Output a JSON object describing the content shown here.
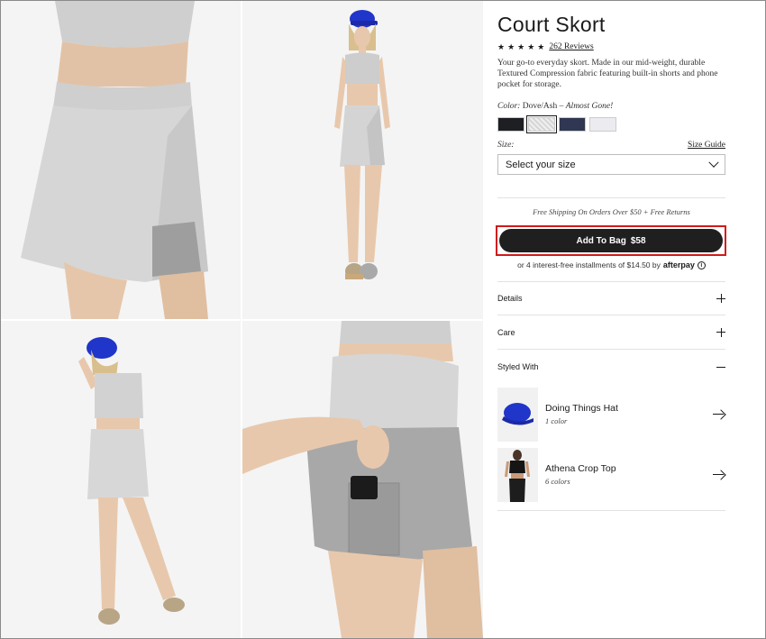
{
  "product": {
    "title": "Court Skort",
    "stars": "★★★★★",
    "reviews": "262 Reviews",
    "description": "Your go-to everyday skort. Made in our mid-weight, durable Textured Compression fabric featuring built-in shorts and phone pocket for storage."
  },
  "color": {
    "label": "Color:",
    "value": "Dove/Ash",
    "separator": "–",
    "availability": "Almost Gone!",
    "swatches": [
      "Black",
      "Dove/Ash",
      "Navy",
      "White"
    ],
    "selected": "Dove/Ash"
  },
  "size": {
    "label": "Size:",
    "guide": "Size Guide",
    "placeholder": "Select your size"
  },
  "shipping": "Free Shipping On Orders Over $50 + Free Returns",
  "add_to_bag": {
    "label": "Add To Bag",
    "price": "$58"
  },
  "afterpay": {
    "text": "or 4 interest-free installments of $14.50 by",
    "brand": "afterpay"
  },
  "accordions": {
    "details": "Details",
    "care": "Care",
    "styled_with": "Styled With"
  },
  "styled_with": [
    {
      "name": "Doing Things Hat",
      "sub": "1 color"
    },
    {
      "name": "Athena Crop Top",
      "sub": "6 colors"
    }
  ],
  "colors": {
    "button_bg": "#1f1f1f",
    "highlight": "#d11a1a",
    "hat_blue": "#2035c9"
  }
}
